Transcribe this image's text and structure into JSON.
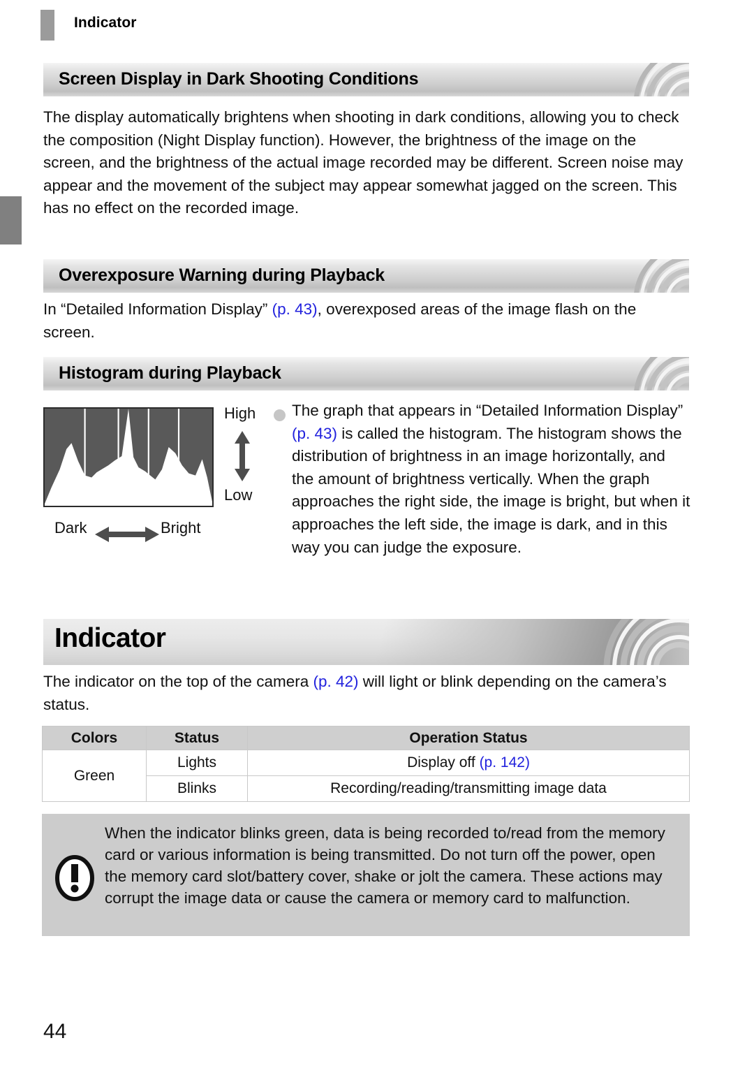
{
  "running_header": {
    "title": "Indicator"
  },
  "sections": [
    {
      "heading": "Screen Display in Dark Shooting Conditions",
      "paragraph": "The display automatically brightens when shooting in dark conditions, allowing you to check the composition (Night Display function). However, the brightness of the image on the screen, and the brightness of the actual image recorded may be different. Screen noise may appear and the movement of the subject may appear somewhat jagged on the screen. This has no effect on the recorded image."
    },
    {
      "heading": "Overexposure Warning during Playback",
      "paragraph_before_link": "In “Detailed Information Display” ",
      "link": "(p. 43)",
      "paragraph_after_link": ", overexposed areas of the image flash on the screen."
    },
    {
      "heading": "Histogram during Playback"
    }
  ],
  "figure": {
    "label_high": "High",
    "label_low": "Low",
    "label_dark": "Dark",
    "label_bright": "Bright"
  },
  "bullet": {
    "text_1": "The graph that appears in “Detailed Information Display” ",
    "link": "(p. 43)",
    "text_2": " is called the histogram. The histogram shows the distribution of brightness in an image horizontally, and the amount of brightness vertically. When the graph approaches the right side, the image is bright, but when it approaches the left side, the image is dark, and in this way you can judge the exposure."
  },
  "chapter": {
    "title": "Indicator",
    "intro_before_link": "The indicator on the top of the camera ",
    "intro_link": "(p. 42)",
    "intro_after_link": " will light or blink depending on the camera’s status."
  },
  "table": {
    "headers": [
      "Colors",
      "Status",
      "Operation Status"
    ],
    "rows": [
      {
        "color": "Green",
        "statuses": [
          {
            "status": "Lights",
            "operation_before_link": "Display off ",
            "operation_link": "(p. 142)",
            "operation_after_link": ""
          },
          {
            "status": "Blinks",
            "operation_before_link": "Recording/reading/transmitting image data",
            "operation_link": "",
            "operation_after_link": ""
          }
        ]
      }
    ]
  },
  "note": {
    "icon": "exclamation-icon",
    "text": "When the indicator blinks green, data is being recorded to/read from the memory card or various information is being transmitted. Do not turn off the power, open the memory card slot/battery cover, shake or jolt the camera. These actions may corrupt the image data or cause the camera or memory card to malfunction."
  },
  "page_number": "44",
  "chart_data": {
    "type": "area",
    "title": "Histogram",
    "xlabel_left": "Dark",
    "xlabel_right": "Bright",
    "ylabel_top": "High",
    "ylabel_bottom": "Low",
    "x": [
      0,
      4,
      9,
      13,
      16,
      20,
      24,
      28,
      31,
      34,
      38,
      42,
      46,
      50,
      53,
      56,
      60,
      63,
      66,
      70,
      74,
      78,
      82,
      86,
      90,
      94,
      97,
      100
    ],
    "values": [
      2,
      18,
      36,
      56,
      62,
      44,
      30,
      28,
      33,
      36,
      40,
      45,
      49,
      96,
      48,
      38,
      34,
      30,
      26,
      36,
      58,
      52,
      40,
      32,
      30,
      46,
      28,
      4
    ],
    "gridlines_x": [
      24,
      44,
      62,
      80
    ],
    "grid": true,
    "plot_background": "#595959",
    "series_fill": "#ffffff",
    "border_color": "#2b2b2b"
  }
}
